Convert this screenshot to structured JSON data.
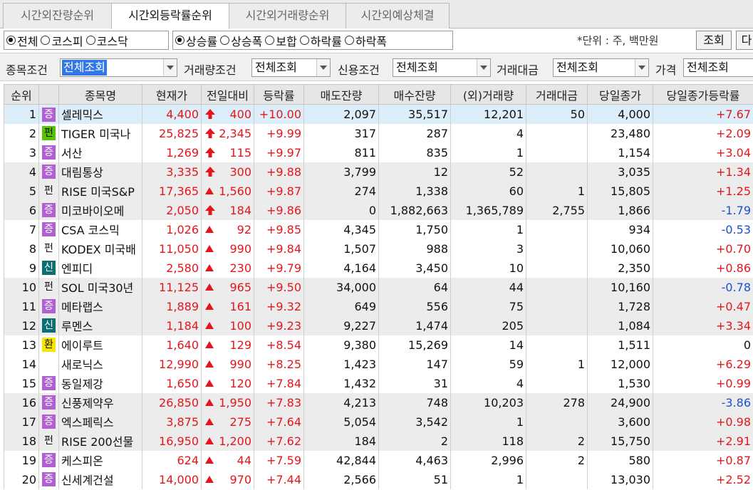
{
  "tabs": [
    {
      "label": "시간외잔량순위",
      "active": false
    },
    {
      "label": "시간외등락률순위",
      "active": true
    },
    {
      "label": "시간외거래량순위",
      "active": false
    },
    {
      "label": "시간외예상체결",
      "active": false
    }
  ],
  "market_radios": [
    {
      "label": "전체",
      "checked": true
    },
    {
      "label": "코스피",
      "checked": false
    },
    {
      "label": "코스닥",
      "checked": false
    }
  ],
  "sort_radios": [
    {
      "label": "상승률",
      "checked": true
    },
    {
      "label": "상승폭",
      "checked": false
    },
    {
      "label": "보합",
      "checked": false
    },
    {
      "label": "하락률",
      "checked": false
    },
    {
      "label": "하락폭",
      "checked": false
    }
  ],
  "unit_text": "*단위 : 주, 백만원",
  "query_button": "조회",
  "next_button": "다",
  "filters": [
    {
      "label": "종목조건",
      "value": "전체조회"
    },
    {
      "label": "거래량조건",
      "value": "전체조회"
    },
    {
      "label": "신용조건",
      "value": "전체조회"
    },
    {
      "label": "거래대금",
      "value": "전체조회"
    },
    {
      "label": "가격",
      "value": "전체조회"
    }
  ],
  "columns": [
    "순위",
    "",
    "종목명",
    "현재가",
    "전일대비",
    "등락률",
    "매도잔량",
    "매수잔량",
    "(외)거래량",
    "거래대금",
    "당일종가",
    "당일종가등락률"
  ],
  "colors": {
    "up": "#e4161c",
    "down": "#1a50d6",
    "badge_증": "#b060d0",
    "badge_펀": "#56c400",
    "badge_신": "#0a6e74",
    "badge_환": "#f7e600",
    "selected_row": "#dceefa"
  },
  "rows": [
    {
      "rank": "1",
      "badge": "증",
      "badge_style": "purple",
      "name": "셀레믹스",
      "price": "4,400",
      "dir": "up-arrow",
      "change": "400",
      "rate": "+10.00",
      "ask_qty": "2,097",
      "bid_qty": "35,517",
      "volume": "12,201",
      "amount": "50",
      "close": "4,000",
      "close_rate": "+7.67"
    },
    {
      "rank": "2",
      "badge": "펀",
      "badge_style": "green",
      "name": "TIGER 미국나",
      "price": "25,825",
      "dir": "up-arrow",
      "change": "2,345",
      "rate": "+9.99",
      "ask_qty": "317",
      "bid_qty": "287",
      "volume": "4",
      "amount": "",
      "close": "23,480",
      "close_rate": "+2.09"
    },
    {
      "rank": "3",
      "badge": "증",
      "badge_style": "purple",
      "name": "서산",
      "price": "1,269",
      "dir": "up-arrow",
      "change": "115",
      "rate": "+9.97",
      "ask_qty": "811",
      "bid_qty": "835",
      "volume": "1",
      "amount": "",
      "close": "1,154",
      "close_rate": "+3.04"
    },
    {
      "rank": "4",
      "badge": "증",
      "badge_style": "purple",
      "name": "대림통상",
      "price": "3,335",
      "dir": "up-arrow",
      "change": "300",
      "rate": "+9.88",
      "ask_qty": "3,799",
      "bid_qty": "12",
      "volume": "52",
      "amount": "",
      "close": "3,035",
      "close_rate": "+1.34"
    },
    {
      "rank": "5",
      "badge": "펀",
      "badge_style": "none",
      "name": "RISE 미국S&P",
      "price": "17,365",
      "dir": "up-triangle",
      "change": "1,560",
      "rate": "+9.87",
      "ask_qty": "274",
      "bid_qty": "1,338",
      "volume": "60",
      "amount": "1",
      "close": "15,805",
      "close_rate": "+1.25"
    },
    {
      "rank": "6",
      "badge": "증",
      "badge_style": "purple",
      "name": "미코바이오메",
      "price": "2,050",
      "dir": "up-arrow",
      "change": "184",
      "rate": "+9.86",
      "ask_qty": "0",
      "bid_qty": "1,882,663",
      "volume": "1,365,789",
      "amount": "2,755",
      "close": "1,866",
      "close_rate": "-1.79"
    },
    {
      "rank": "7",
      "badge": "증",
      "badge_style": "purple",
      "name": "CSA 코스믹",
      "price": "1,026",
      "dir": "up-triangle",
      "change": "92",
      "rate": "+9.85",
      "ask_qty": "4,345",
      "bid_qty": "1,750",
      "volume": "1",
      "amount": "",
      "close": "934",
      "close_rate": "-0.53"
    },
    {
      "rank": "8",
      "badge": "펀",
      "badge_style": "none",
      "name": "KODEX 미국배",
      "price": "11,050",
      "dir": "up-triangle",
      "change": "990",
      "rate": "+9.84",
      "ask_qty": "1,507",
      "bid_qty": "988",
      "volume": "3",
      "amount": "",
      "close": "10,060",
      "close_rate": "+0.70"
    },
    {
      "rank": "9",
      "badge": "신",
      "badge_style": "teal",
      "name": "엔피디",
      "price": "2,580",
      "dir": "up-triangle",
      "change": "230",
      "rate": "+9.79",
      "ask_qty": "4,164",
      "bid_qty": "3,450",
      "volume": "10",
      "amount": "",
      "close": "2,350",
      "close_rate": "+0.86"
    },
    {
      "rank": "10",
      "badge": "펀",
      "badge_style": "none",
      "name": "SOL 미국30년",
      "price": "11,125",
      "dir": "up-triangle",
      "change": "965",
      "rate": "+9.50",
      "ask_qty": "34,000",
      "bid_qty": "64",
      "volume": "44",
      "amount": "",
      "close": "10,160",
      "close_rate": "-0.78"
    },
    {
      "rank": "11",
      "badge": "증",
      "badge_style": "purple",
      "name": "메타랩스",
      "price": "1,889",
      "dir": "up-triangle",
      "change": "161",
      "rate": "+9.32",
      "ask_qty": "649",
      "bid_qty": "556",
      "volume": "75",
      "amount": "",
      "close": "1,728",
      "close_rate": "+0.47"
    },
    {
      "rank": "12",
      "badge": "신",
      "badge_style": "teal",
      "name": "루멘스",
      "price": "1,184",
      "dir": "up-triangle",
      "change": "100",
      "rate": "+9.23",
      "ask_qty": "9,227",
      "bid_qty": "1,474",
      "volume": "205",
      "amount": "",
      "close": "1,084",
      "close_rate": "+3.34"
    },
    {
      "rank": "13",
      "badge": "환",
      "badge_style": "yellow",
      "name": "에이루트",
      "price": "1,640",
      "dir": "up-triangle",
      "change": "129",
      "rate": "+8.54",
      "ask_qty": "9,380",
      "bid_qty": "15,269",
      "volume": "14",
      "amount": "",
      "close": "1,511",
      "close_rate": "0"
    },
    {
      "rank": "14",
      "badge": "",
      "badge_style": "none",
      "name": "새로닉스",
      "price": "12,990",
      "dir": "up-triangle",
      "change": "990",
      "rate": "+8.25",
      "ask_qty": "1,423",
      "bid_qty": "147",
      "volume": "59",
      "amount": "1",
      "close": "12,000",
      "close_rate": "+6.29"
    },
    {
      "rank": "15",
      "badge": "증",
      "badge_style": "purple",
      "name": "동일제강",
      "price": "1,650",
      "dir": "up-triangle",
      "change": "120",
      "rate": "+7.84",
      "ask_qty": "1,432",
      "bid_qty": "31",
      "volume": "4",
      "amount": "",
      "close": "1,530",
      "close_rate": "+0.99"
    },
    {
      "rank": "16",
      "badge": "증",
      "badge_style": "purple",
      "name": "신풍제약우",
      "price": "26,850",
      "dir": "up-triangle",
      "change": "1,950",
      "rate": "+7.83",
      "ask_qty": "4,213",
      "bid_qty": "748",
      "volume": "10,203",
      "amount": "278",
      "close": "24,900",
      "close_rate": "-3.86"
    },
    {
      "rank": "17",
      "badge": "증",
      "badge_style": "purple",
      "name": "엑스페릭스",
      "price": "3,875",
      "dir": "up-triangle",
      "change": "275",
      "rate": "+7.64",
      "ask_qty": "5,054",
      "bid_qty": "3,542",
      "volume": "1",
      "amount": "",
      "close": "3,600",
      "close_rate": "+0.98"
    },
    {
      "rank": "18",
      "badge": "펀",
      "badge_style": "none",
      "name": "RISE 200선물",
      "price": "16,950",
      "dir": "up-triangle",
      "change": "1,200",
      "rate": "+7.62",
      "ask_qty": "184",
      "bid_qty": "2",
      "volume": "118",
      "amount": "2",
      "close": "15,750",
      "close_rate": "+2.91"
    },
    {
      "rank": "19",
      "badge": "증",
      "badge_style": "purple",
      "name": "케스피온",
      "price": "624",
      "dir": "up-triangle",
      "change": "44",
      "rate": "+7.59",
      "ask_qty": "42,844",
      "bid_qty": "4,463",
      "volume": "2,996",
      "amount": "2",
      "close": "580",
      "close_rate": "+0.87"
    },
    {
      "rank": "20",
      "badge": "증",
      "badge_style": "purple",
      "name": "신세계건설",
      "price": "14,000",
      "dir": "up-triangle",
      "change": "970",
      "rate": "+7.44",
      "ask_qty": "2,566",
      "bid_qty": "51",
      "volume": "1",
      "amount": "",
      "close": "13,030",
      "close_rate": "+2.52"
    }
  ]
}
